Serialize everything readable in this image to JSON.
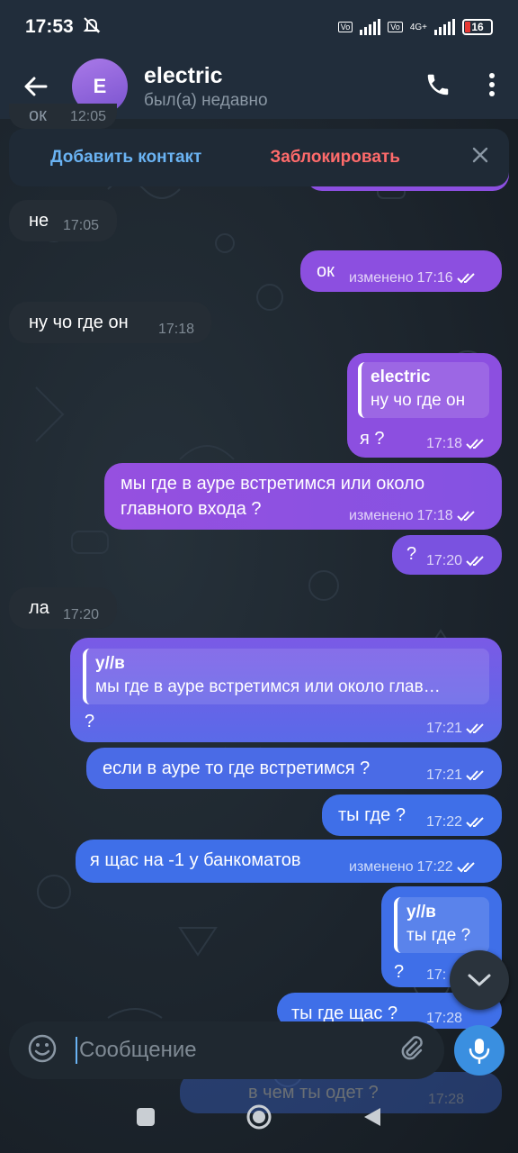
{
  "status_bar": {
    "time": "17:53",
    "battery": "16",
    "net": "4G+"
  },
  "header": {
    "avatar_letter": "E",
    "name": "electric",
    "status": "был(а) недавно"
  },
  "action_bar": {
    "add_contact": "Добавить контакт",
    "block": "Заблокировать"
  },
  "messages": [
    {
      "text": "ок",
      "time": "12:05"
    },
    {
      "text": "не",
      "time": "17:05"
    },
    {
      "text": "ок",
      "edited": "изменено",
      "time": "17:16"
    },
    {
      "text": "ну чо где он",
      "time": "17:18"
    },
    {
      "reply_name": "electric",
      "reply_text": "ну чо где он",
      "text": "я ?",
      "time": "17:18"
    },
    {
      "text_line1": "мы где в ауре встретимся или около",
      "text_line2": "главного входа ?",
      "edited": "изменено",
      "time": "17:18"
    },
    {
      "text": "?",
      "time": "17:20"
    },
    {
      "text": "ла",
      "time": "17:20"
    },
    {
      "reply_name": "у//в",
      "reply_text": "мы где в ауре встретимся или около глав…",
      "text": "?",
      "time": "17:21"
    },
    {
      "text": "если в ауре то где встретимся ?",
      "time": "17:21"
    },
    {
      "text": "ты где ?",
      "time": "17:22"
    },
    {
      "text": "я щас на -1 у банкоматов",
      "edited": "изменено",
      "time": "17:22"
    },
    {
      "reply_name": "у//в",
      "reply_text": "ты где ?",
      "text": "?",
      "time": "17:"
    },
    {
      "text": "ты где щас ?",
      "time": "17:28"
    },
    {
      "text": "в чем ты одет ?",
      "time": "17:28"
    }
  ],
  "composer": {
    "placeholder": "Сообщение"
  },
  "colors": {
    "accent": "#6ab3f3",
    "danger": "#ff6b6b",
    "bubble_in": "#252d35",
    "bubble_out_purple": "#8c4fe0",
    "bubble_out_blue": "#4a6be6",
    "mic": "#3a8fe0"
  }
}
